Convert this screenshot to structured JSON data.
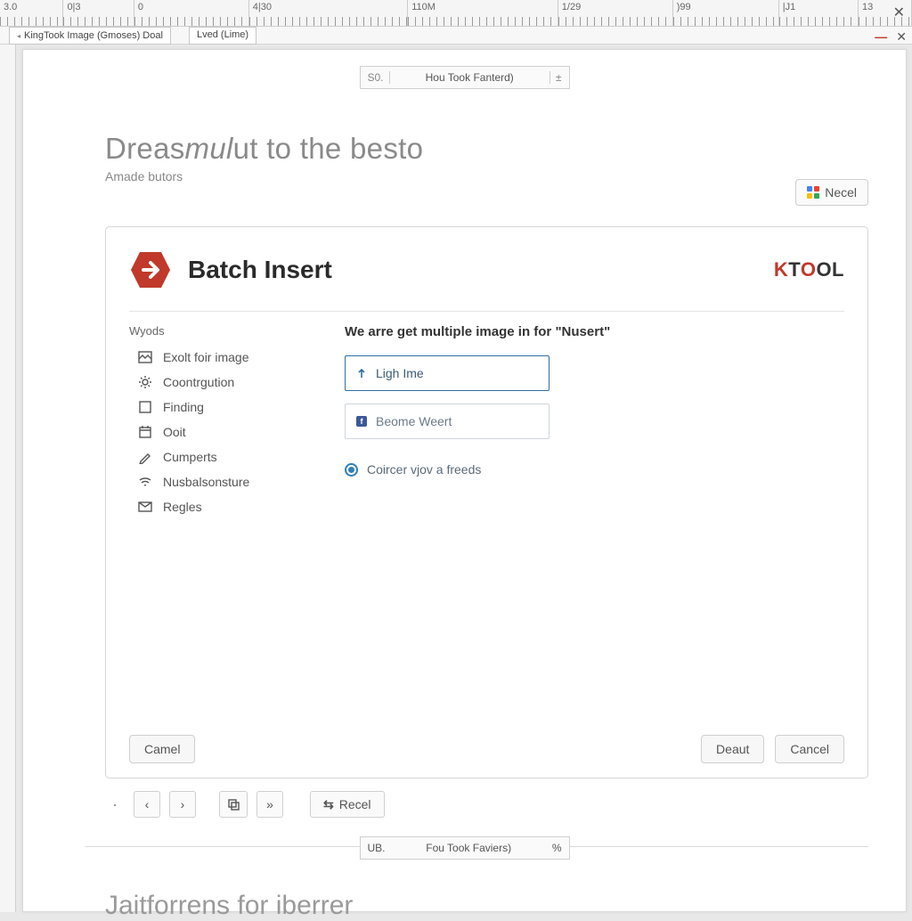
{
  "ruler": {
    "marks": [
      "3.0",
      "0|3",
      "0",
      "4|30",
      "110M",
      "1/29",
      ")99",
      "|J1",
      "13"
    ]
  },
  "tabs": {
    "main": "KingTook Image (Gmoses) Doal",
    "second": "Lved  (Lime)"
  },
  "header_pill": {
    "lead": "S0.",
    "label": "Hou Took Fanterd)",
    "trail": "±"
  },
  "doc": {
    "title_a": "Dreas",
    "title_b": "mul",
    "title_c": "ut to the besto",
    "subtitle": "Amade butors"
  },
  "top_button": "Necel",
  "panel": {
    "title": "Batch Insert",
    "brand": "KTOOL",
    "side_header": "Wyods",
    "side_items": [
      "Exolt foir image",
      "Coontrgution",
      "Finding",
      "Ooit",
      "Cumperts",
      "Nusbalsonsture",
      "Regles"
    ],
    "main_header": "We arre get multiple image in for \"Nusert\"",
    "option1": "Ligh Ime",
    "option2": "Beome Weert",
    "radio_label": "Coircer vjov a freeds",
    "buttons": {
      "left": "Camel",
      "deaut": "Deaut",
      "cancel": "Cancel"
    }
  },
  "pager": {
    "recel": "Recel"
  },
  "footer_pill": {
    "lead": "UB.",
    "label": "Fou Took Faviers)",
    "trail": "%"
  },
  "footer_title": "Jaitforrens for iberrer"
}
